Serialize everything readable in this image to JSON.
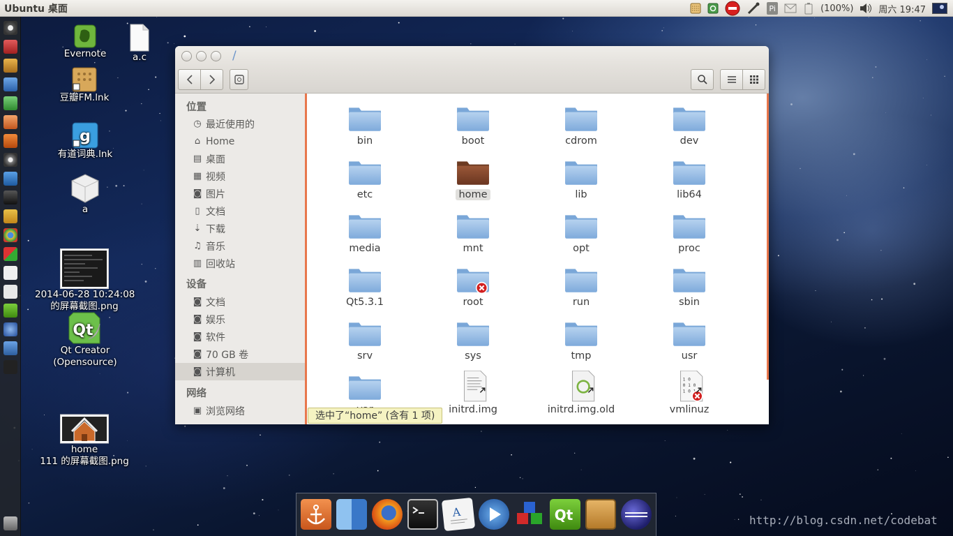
{
  "top_panel": {
    "title": "Ubuntu 桌面",
    "battery": "(100%)",
    "clock": "周六 19:47",
    "input_method": "Pi"
  },
  "launcher": {
    "icons": [
      "dash-icon",
      "app-icon",
      "files-icon",
      "writer-icon",
      "calc-icon",
      "impress-icon",
      "software-center-icon",
      "disk-icon",
      "media-icon",
      "terminal-icon",
      "puzzle-icon",
      "chrome-icon",
      "blocks-icon",
      "amazon-icon",
      "doc-icon",
      "qt-icon",
      "globe-icon",
      "image-icon",
      "terminal-small-icon",
      "trash-icon"
    ]
  },
  "desktop": {
    "icons": [
      {
        "id": "evernote",
        "label": "Evernote"
      },
      {
        "id": "a-c",
        "label": "a.c"
      },
      {
        "id": "douban",
        "label": "豆瓣FM.lnk"
      },
      {
        "id": "youdao",
        "label": "有道词典.lnk"
      },
      {
        "id": "a",
        "label": "a"
      },
      {
        "id": "screenshot1",
        "label1": "2014-06-28 10:24:08",
        "label2": "的屏幕截图.png"
      },
      {
        "id": "qtcreator",
        "label1": "Qt Creator",
        "label2": "(Opensource)"
      },
      {
        "id": "home",
        "label1": "home",
        "label2": "111 的屏幕截图.png"
      }
    ]
  },
  "window": {
    "path": "/",
    "sidebar": {
      "places_header": "位置",
      "places": [
        "最近使用的",
        "Home",
        "桌面",
        "视频",
        "图片",
        "文档",
        "下载",
        "音乐",
        "回收站"
      ],
      "devices_header": "设备",
      "devices": [
        "文档",
        "娱乐",
        "软件",
        "70 GB 卷",
        "计算机"
      ],
      "network_header": "网络",
      "network": [
        "浏览网络"
      ]
    },
    "files": [
      {
        "name": "bin",
        "kind": "folder"
      },
      {
        "name": "boot",
        "kind": "folder"
      },
      {
        "name": "cdrom",
        "kind": "folder"
      },
      {
        "name": "dev",
        "kind": "folder"
      },
      {
        "name": "etc",
        "kind": "folder"
      },
      {
        "name": "home",
        "kind": "home-folder"
      },
      {
        "name": "lib",
        "kind": "folder"
      },
      {
        "name": "lib64",
        "kind": "folder"
      },
      {
        "name": "media",
        "kind": "folder"
      },
      {
        "name": "mnt",
        "kind": "folder"
      },
      {
        "name": "opt",
        "kind": "folder"
      },
      {
        "name": "proc",
        "kind": "folder"
      },
      {
        "name": "Qt5.3.1",
        "kind": "folder"
      },
      {
        "name": "root",
        "kind": "locked-folder"
      },
      {
        "name": "run",
        "kind": "folder"
      },
      {
        "name": "sbin",
        "kind": "folder"
      },
      {
        "name": "srv",
        "kind": "folder"
      },
      {
        "name": "sys",
        "kind": "folder"
      },
      {
        "name": "tmp",
        "kind": "folder"
      },
      {
        "name": "usr",
        "kind": "folder"
      },
      {
        "name": "var",
        "kind": "folder"
      },
      {
        "name": "initrd.img",
        "kind": "text-link"
      },
      {
        "name": "initrd.img.old",
        "kind": "archive-link"
      },
      {
        "name": "vmlinuz",
        "kind": "binary-locked"
      }
    ],
    "status": "选中了“home” (含有 1 项)"
  },
  "dock": {
    "icons": [
      "anchor-icon",
      "finder-icon",
      "firefox-icon",
      "terminal-icon",
      "text-editor-icon",
      "media-player-icon",
      "cubes-icon",
      "qt-icon",
      "radio-icon",
      "eclipse-icon"
    ]
  },
  "watermark": "http://blog.csdn.net/codebat"
}
